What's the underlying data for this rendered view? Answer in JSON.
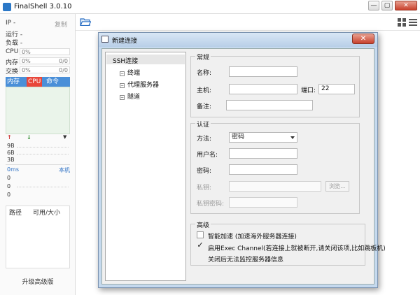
{
  "window": {
    "title": "FinalShell 3.0.10",
    "min": "—",
    "max": "▢",
    "close": "✕"
  },
  "sidebar": {
    "ip_label": "IP",
    "ip_value": "-",
    "copy": "复制",
    "running": "运行 -",
    "load": "负载 -",
    "cpu_label": "CPU",
    "cpu_value": "0%",
    "mem_label": "内存",
    "mem_value": "0%",
    "mem_right": "0/0",
    "swap_label": "交换",
    "swap_value": "0%",
    "swap_right": "0/0",
    "proc_tabs": [
      "内存",
      "CPU",
      "命令"
    ],
    "up_arrow": "↑",
    "down_arrow": "↓",
    "menu_arrow": "▼",
    "net_values": [
      "9B",
      "6B",
      "3B"
    ],
    "ping_label": "0ms",
    "ping_host": "本机",
    "ping_values": [
      "0",
      "0",
      "0"
    ],
    "file_col_path": "路径",
    "file_col_size": "可用/大小",
    "upgrade": "升级高级版"
  },
  "dialog": {
    "title": "新建连接",
    "close": "✕",
    "tree": [
      {
        "label": "SSH连接",
        "toggle": ""
      },
      {
        "label": "终端",
        "toggle": "⊟"
      },
      {
        "label": "代理服务器",
        "toggle": "⊟"
      },
      {
        "label": "隧道",
        "toggle": "⊟"
      }
    ],
    "general": {
      "legend": "常规",
      "name_label": "名称:",
      "name_value": "",
      "host_label": "主机:",
      "host_value": "",
      "port_label": "端口:",
      "port_value": "22",
      "note_label": "备注:",
      "note_value": ""
    },
    "auth": {
      "legend": "认证",
      "method_label": "方法:",
      "method_value": "密码",
      "user_label": "用户名:",
      "user_value": "",
      "pass_label": "密码:",
      "pass_value": "",
      "key_label": "私钥:",
      "key_value": "",
      "browse": "浏览...",
      "keypass_label": "私钥密码:",
      "keypass_value": ""
    },
    "advanced": {
      "legend": "高级",
      "smart_accel": {
        "checked": false,
        "label": "智能加速 (加速海外服务器连接)"
      },
      "exec_channel": {
        "checked": true,
        "label": "启用Exec Channel(若连接上就被断开,请关闭该项,比如跳板机)"
      },
      "exec_note": "关闭后无法监控服务器信息"
    }
  },
  "colors": {
    "accent": "#4a8fd8",
    "proc_tab_active": "#e8463a",
    "close_red": "#c8402c",
    "dialog_frame": "#c5d9ee"
  }
}
